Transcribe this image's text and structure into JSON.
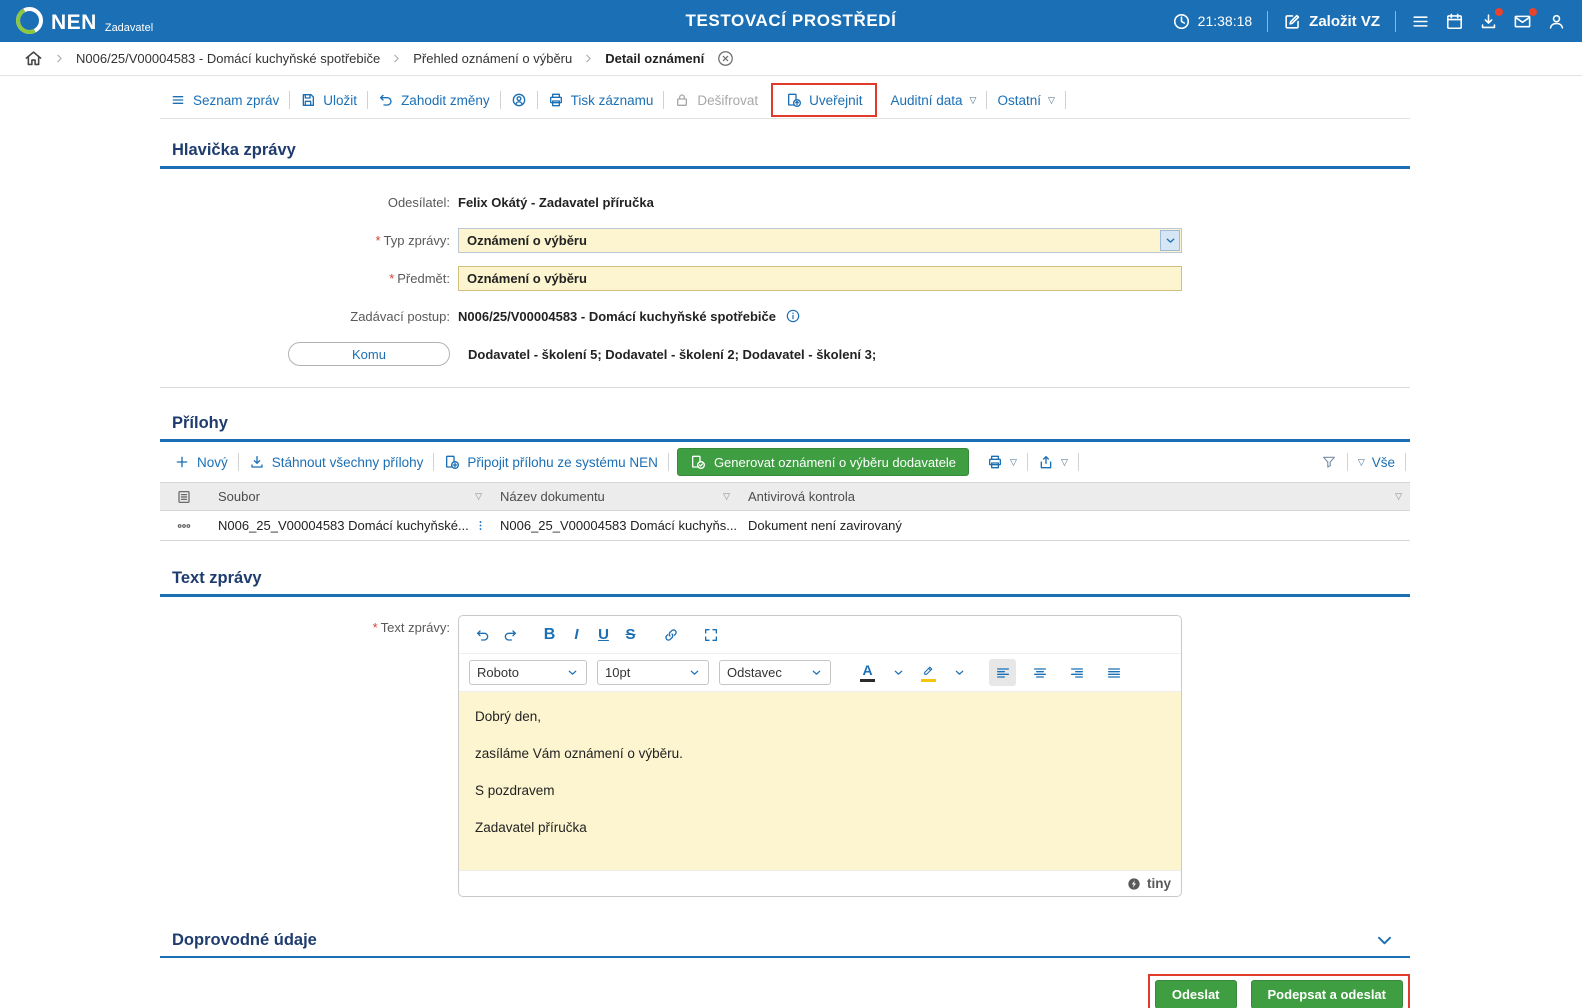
{
  "colors": {
    "accent_blue": "#1b6fb5",
    "logo_green": "#8dc63f",
    "button_green": "#3f9e42",
    "annotation_red": "#e03a2a",
    "input_yellow": "#fcf5d0",
    "section_title": "#1e3c6e"
  },
  "topbar": {
    "brand": "NEN",
    "brand_sub": "Zadavatel",
    "env_title": "TESTOVACÍ PROSTŘEDÍ",
    "time": "21:38:18",
    "create_vz": "Založit VZ"
  },
  "breadcrumb": {
    "items": [
      "N006/25/V00004583 - Domácí kuchyňské spotřebiče",
      "Přehled oznámení o výběru",
      "Detail oznámení"
    ]
  },
  "toolbar": {
    "seznam": "Seznam zpráv",
    "ulozit": "Uložit",
    "zahodit": "Zahodit změny",
    "tisk": "Tisk záznamu",
    "desifrovat": "Dešifrovat",
    "uverejnit": "Uveřejnit",
    "auditni": "Auditní data",
    "ostatni": "Ostatní"
  },
  "form": {
    "title": "Hlavička zprávy",
    "odesilatel_label": "Odesílatel:",
    "odesilatel_value": "Felix Okátý - Zadavatel příručka",
    "typ_label": "Typ zprávy:",
    "typ_value": "Oznámení o výběru",
    "predmet_label": "Předmět:",
    "predmet_value": "Oznámení o výběru",
    "postup_label": "Zadávací postup:",
    "postup_value": "N006/25/V00004583 - Domácí kuchyňské spotřebiče",
    "komu_label": "Komu",
    "komu_value": "Dodavatel - školení 5; Dodavatel - školení 2; Dodavatel - školení 3;"
  },
  "attachments": {
    "title": "Přílohy",
    "novy": "Nový",
    "stahnout": "Stáhnout všechny přílohy",
    "pripojit": "Připojit přílohu ze systému NEN",
    "generovat": "Generovat oznámení o výběru dodavatele",
    "vse": "Vše",
    "table": {
      "headers": [
        "Soubor",
        "Název dokumentu",
        "Antivirová kontrola"
      ],
      "rows": [
        {
          "soubor": "N006_25_V00004583 Domácí kuchyňské...",
          "nazev": "N006_25_V00004583 Domácí kuchyňs...",
          "antivirus": "Dokument není zavirovaný"
        }
      ]
    }
  },
  "message": {
    "title": "Text zprávy",
    "label": "Text zprávy:",
    "editor": {
      "font": "Roboto",
      "size": "10pt",
      "block": "Odstavec",
      "bold": "B",
      "italic": "I",
      "underline": "U",
      "strike": "S",
      "forecolor": "A",
      "lines": [
        "Dobrý den,",
        "zasíláme Vám oznámení o výběru.",
        "S pozdravem",
        "Zadavatel příručka"
      ],
      "brand": "tiny"
    }
  },
  "accompanying": {
    "title": "Doprovodné údaje"
  },
  "actions": {
    "send": "Odeslat",
    "sign_send": "Podepsat a odeslat"
  }
}
